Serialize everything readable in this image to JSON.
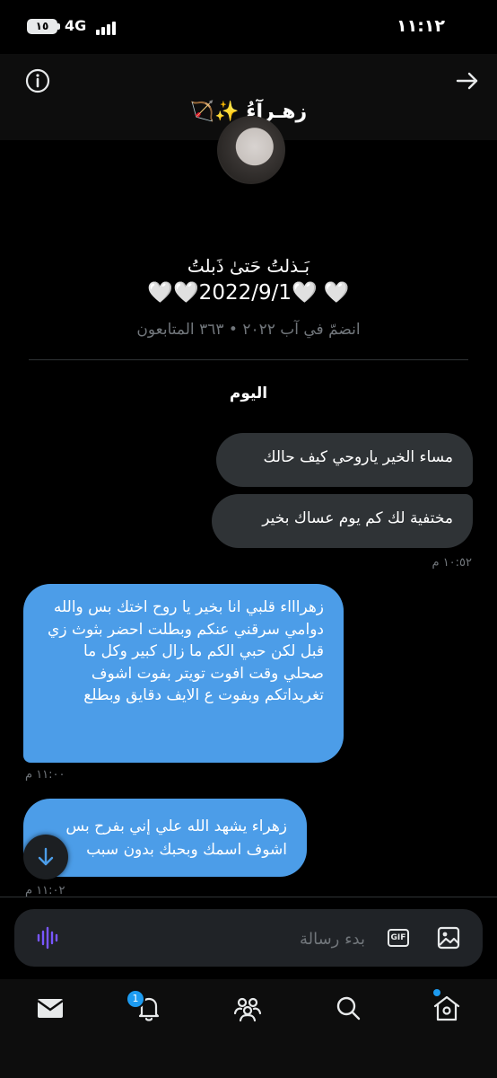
{
  "status_bar": {
    "battery": "١٥",
    "network": "4G",
    "time": "١١:١٢"
  },
  "header": {
    "chat_title": "زهـرآءُ ✨🏹",
    "bio_line1": "بَـذلتُ حَتىٰ ذَبلتُ",
    "bio_line2": "🤍🤍2022/9/1🤍 🤍",
    "profile_meta": "انضمّ في آب ٢٠٢٢ • ٣٦٣ المتابعون"
  },
  "conversation": {
    "day_label": "اليوم",
    "messages": [
      {
        "text": "مساء الخير ياروحي كيف حالك",
        "direction": "received"
      },
      {
        "text": "مختفية لك كم يوم عساك بخير",
        "direction": "received",
        "time": "١٠:٥٢ م"
      },
      {
        "text": "زهراااء قلبي انا بخير يا روح اختك بس والله دوامي سرقني عنكم وبطلت احضر بثوث زي قبل لكن حبي الكم ما زال كبير وكل ما صحلي وقت افوت تويتر بفوت اشوف تغريداتكم وبفوت ع الايف دقايق وبطلع",
        "direction": "sent",
        "time": "١١:٠٠ م"
      },
      {
        "text": "زهراء يشهد الله علي إني بفرح بس اشوف اسمك وبحبك بدون سبب",
        "direction": "sent",
        "time": "١١:٠٢ م"
      }
    ]
  },
  "composer": {
    "placeholder": "بدء رسالة",
    "gif_label": "GIF"
  },
  "tab_bar": {
    "notification_count": "1"
  },
  "icons": {
    "info": "info-icon",
    "back": "arrow-right-icon",
    "voice": "voice-waveform-icon",
    "gif": "gif-icon",
    "image": "image-icon",
    "scroll_down": "arrow-down-icon",
    "messages": "envelope-icon",
    "notifications": "bell-icon",
    "communities": "people-icon",
    "search": "search-icon",
    "home": "home-icon"
  },
  "colors": {
    "background": "#000000",
    "received_bubble": "#2f3336",
    "sent_bubble": "#4c9de8",
    "accent": "#1d9bf0",
    "voice_icon": "#7856ff"
  }
}
